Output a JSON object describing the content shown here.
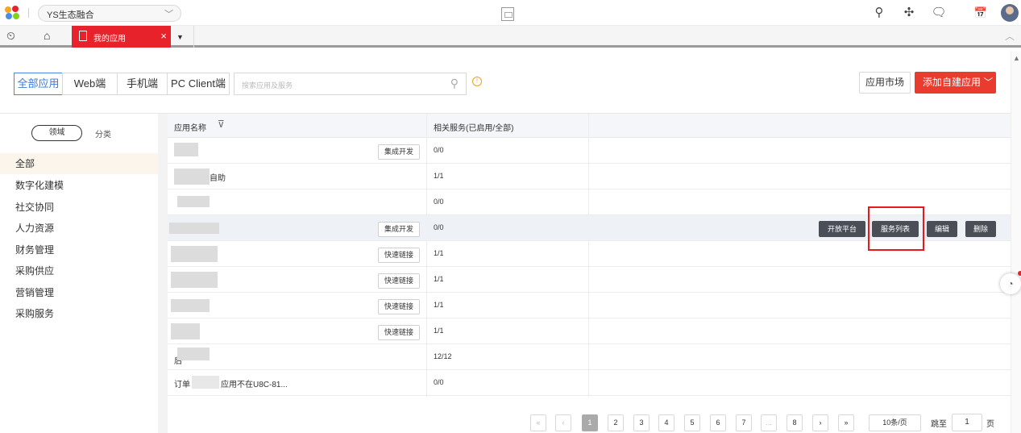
{
  "tenant": {
    "name": "YS生态融合"
  },
  "tabbar": {
    "active_tab": "我的应用"
  },
  "filters": {
    "segments": [
      "全部应用",
      "Web端",
      "手机端",
      "PC Client端"
    ],
    "search_placeholder": "搜索应用及服务",
    "market_label": "应用市场",
    "add_label": "添加自建应用"
  },
  "sidebar": {
    "toggle_domain": "领域",
    "toggle_category": "分类",
    "items": [
      "全部",
      "数字化建模",
      "社交协同",
      "人力资源",
      "财务管理",
      "采购供应",
      "营销管理",
      "采购服务"
    ]
  },
  "table": {
    "col_name": "应用名称",
    "col_service": "相关服务(已启用/全部)",
    "rows": [
      {
        "name": "",
        "tag": "集成开发",
        "count": "0/0"
      },
      {
        "name": "自助",
        "tag": "",
        "count": "1/1"
      },
      {
        "name": "",
        "tag": "",
        "count": "0/0"
      },
      {
        "name": "",
        "tag": "集成开发",
        "count": "0/0"
      },
      {
        "name": "",
        "tag": "快速链接",
        "count": "1/1"
      },
      {
        "name": "",
        "tag": "快速链接",
        "count": "1/1"
      },
      {
        "name": "",
        "tag": "快速链接",
        "count": "1/1"
      },
      {
        "name": "",
        "tag": "快速链接",
        "count": "1/1"
      },
      {
        "name": "后",
        "tag": "",
        "count": "12/12"
      },
      {
        "name": "订单",
        "name_tail": "应用不在U8C-81...",
        "tag": "",
        "count": "0/0"
      }
    ],
    "actions": {
      "open_platform": "开放平台",
      "service_list": "服务列表",
      "edit": "编辑",
      "delete": "删除"
    }
  },
  "pagination": {
    "first": "«",
    "prev": "‹",
    "pages": [
      "1",
      "2",
      "3",
      "4",
      "5",
      "6",
      "7",
      "...",
      "8"
    ],
    "next": "›",
    "last": "»",
    "page_size": "10条/页",
    "jump_label": "跳至",
    "jump_value": "1",
    "page_label": "页"
  }
}
